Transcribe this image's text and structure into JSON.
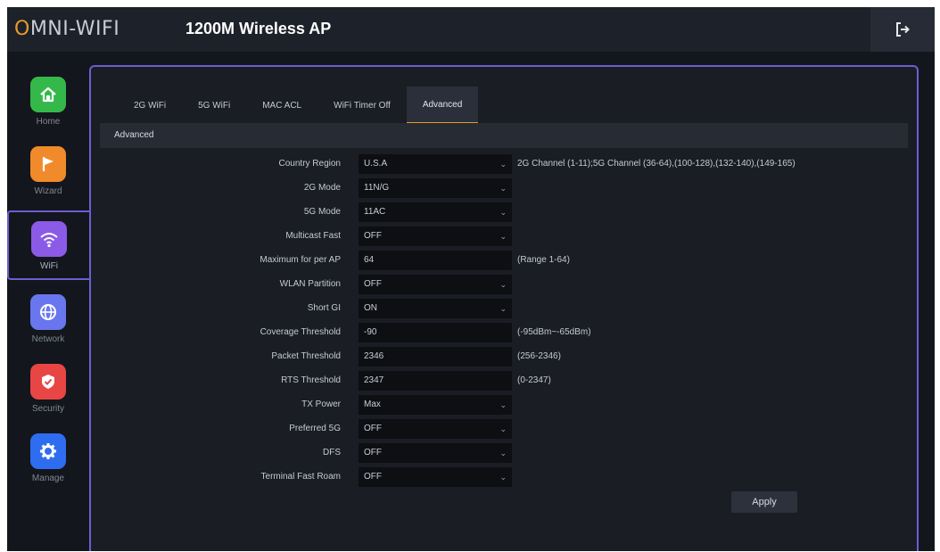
{
  "header": {
    "logo_prefix": "O",
    "logo_rest": "MNI-WIFI",
    "title": "1200M Wireless AP"
  },
  "sidebar": {
    "items": [
      {
        "label": "Home",
        "icon": "home-icon",
        "color": "#35b84a"
      },
      {
        "label": "Wizard",
        "icon": "flag-icon",
        "color": "#f08a2a"
      },
      {
        "label": "WiFi",
        "icon": "wifi-icon",
        "color": "#8b5ae6"
      },
      {
        "label": "Network",
        "icon": "globe-icon",
        "color": "#6a76ee"
      },
      {
        "label": "Security",
        "icon": "shield-icon",
        "color": "#e84545"
      },
      {
        "label": "Manage",
        "icon": "gear-icon",
        "color": "#2f6df0"
      }
    ],
    "active": "WiFi"
  },
  "tabs": [
    "2G WiFi",
    "5G WiFi",
    "MAC ACL",
    "WiFi Timer Off",
    "Advanced"
  ],
  "active_tab": "Advanced",
  "section_title": "Advanced",
  "form": {
    "rows": [
      {
        "label": "Country Region",
        "value": "U.S.A",
        "type": "select",
        "hint": "2G Channel (1-11);5G Channel (36-64),(100-128),(132-140),(149-165)"
      },
      {
        "label": "2G Mode",
        "value": "11N/G",
        "type": "select",
        "hint": ""
      },
      {
        "label": "5G Mode",
        "value": "11AC",
        "type": "select",
        "hint": ""
      },
      {
        "label": "Multicast Fast",
        "value": "OFF",
        "type": "select",
        "hint": ""
      },
      {
        "label": "Maximum for per AP",
        "value": "64",
        "type": "input",
        "hint": "(Range 1-64)"
      },
      {
        "label": "WLAN Partition",
        "value": "OFF",
        "type": "select",
        "hint": ""
      },
      {
        "label": "Short GI",
        "value": "ON",
        "type": "select",
        "hint": ""
      },
      {
        "label": "Coverage Threshold",
        "value": "-90",
        "type": "input",
        "hint": "(-95dBm~-65dBm)"
      },
      {
        "label": "Packet Threshold",
        "value": "2346",
        "type": "input",
        "hint": "(256-2346)"
      },
      {
        "label": "RTS Threshold",
        "value": "2347",
        "type": "input",
        "hint": "(0-2347)"
      },
      {
        "label": "TX Power",
        "value": "Max",
        "type": "select",
        "hint": ""
      },
      {
        "label": "Preferred 5G",
        "value": "OFF",
        "type": "select",
        "hint": ""
      },
      {
        "label": "DFS",
        "value": "OFF",
        "type": "select",
        "hint": ""
      },
      {
        "label": "Terminal Fast Roam",
        "value": "OFF",
        "type": "select",
        "hint": ""
      }
    ],
    "apply_label": "Apply"
  },
  "colors": {
    "accent": "#6b5fd1",
    "tab_underline": "#e89a2c"
  }
}
